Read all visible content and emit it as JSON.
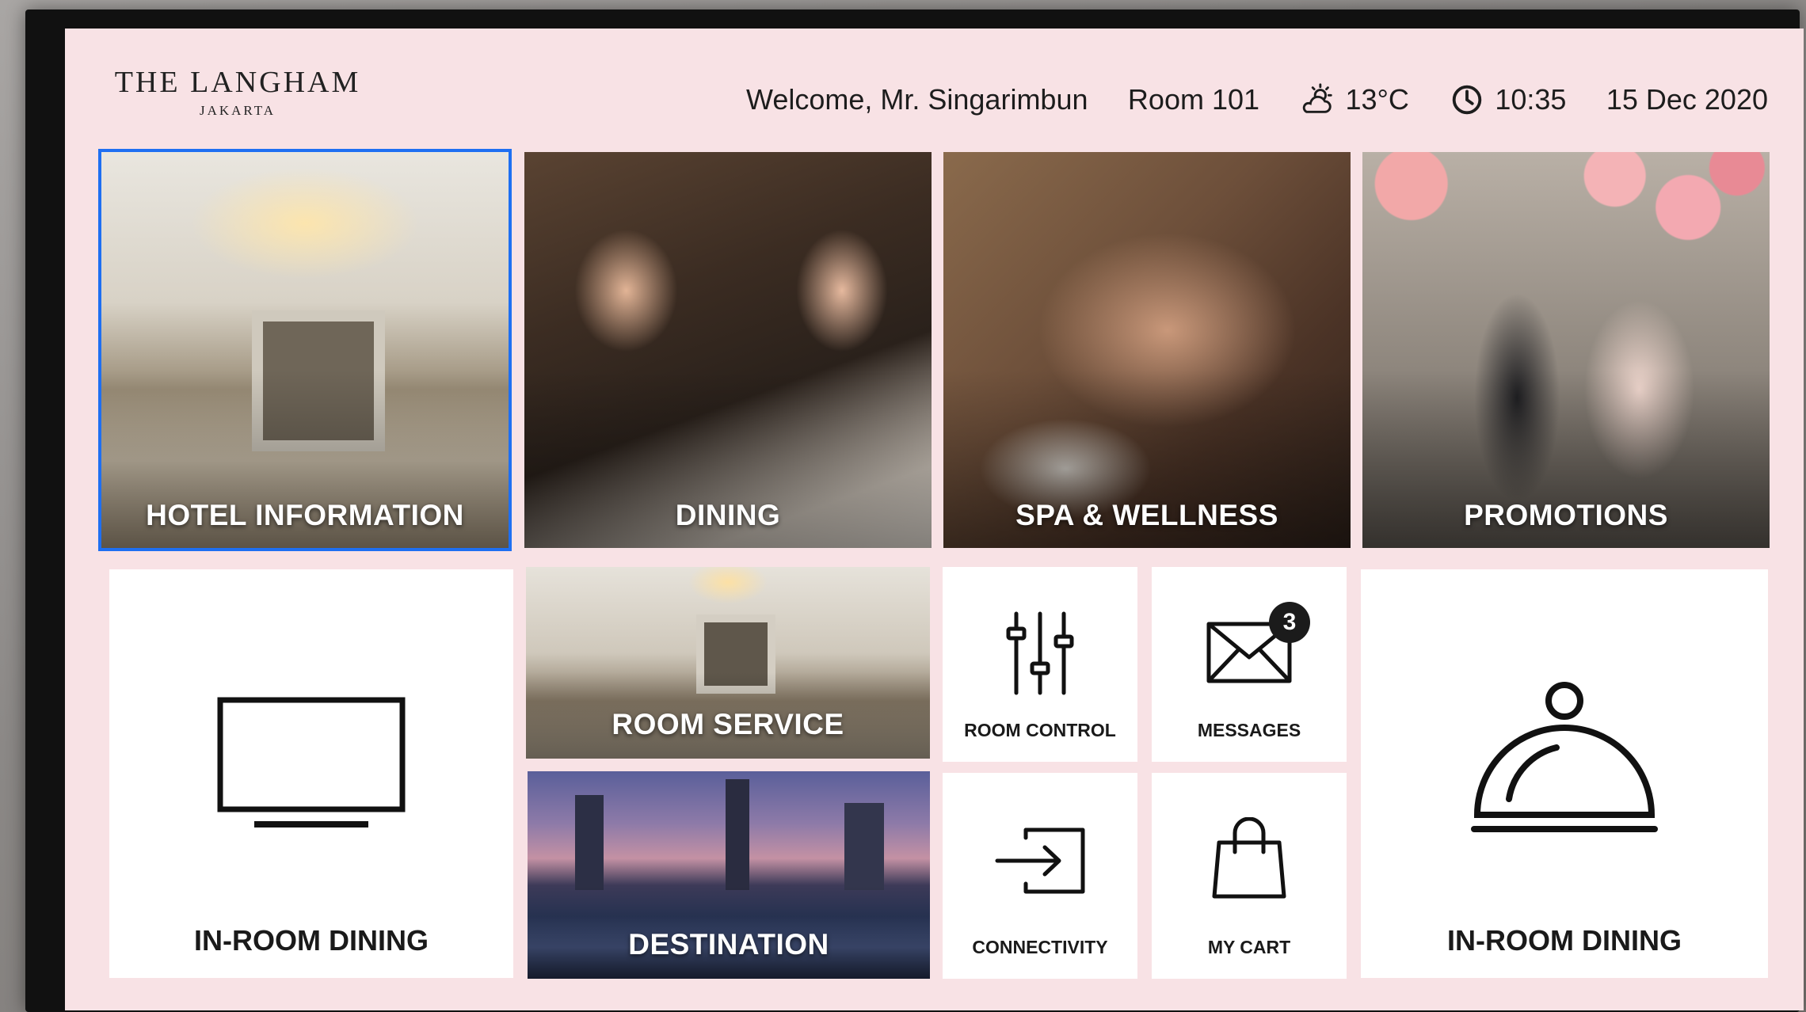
{
  "logo": {
    "name": "THE LANGHAM",
    "location": "JAKARTA"
  },
  "header": {
    "welcome": "Welcome, Mr. Singarimbun",
    "room": "Room 101",
    "weather_icon": "partly-cloudy-icon",
    "temperature": "13°C",
    "clock_icon": "clock-icon",
    "time": "10:35",
    "date": "15 Dec 2020"
  },
  "tiles": {
    "hotel_information": {
      "label": "HOTEL INFORMATION",
      "selected": true
    },
    "dining": {
      "label": "DINING"
    },
    "spa": {
      "label": "SPA & WELLNESS"
    },
    "promotions": {
      "label": "PROMOTIONS"
    },
    "in_room_dining_tv": {
      "label": "IN-ROOM DINING",
      "icon": "tv-icon"
    },
    "room_service": {
      "label": "ROOM SERVICE"
    },
    "destination": {
      "label": "DESTINATION"
    },
    "room_control": {
      "label": "ROOM CONTROL",
      "icon": "sliders-icon"
    },
    "messages": {
      "label": "MESSAGES",
      "icon": "envelope-icon",
      "badge_count": "3"
    },
    "connectivity": {
      "label": "CONNECTIVITY",
      "icon": "input-arrow-icon"
    },
    "my_cart": {
      "label": "MY CART",
      "icon": "shopping-bag-icon"
    },
    "in_room_dining_cloche": {
      "label": "IN-ROOM DINING",
      "icon": "cloche-icon"
    }
  },
  "colors": {
    "screen_bg": "#f8e2e5",
    "selection": "#1e6ff2",
    "text": "#1d1d1d"
  }
}
